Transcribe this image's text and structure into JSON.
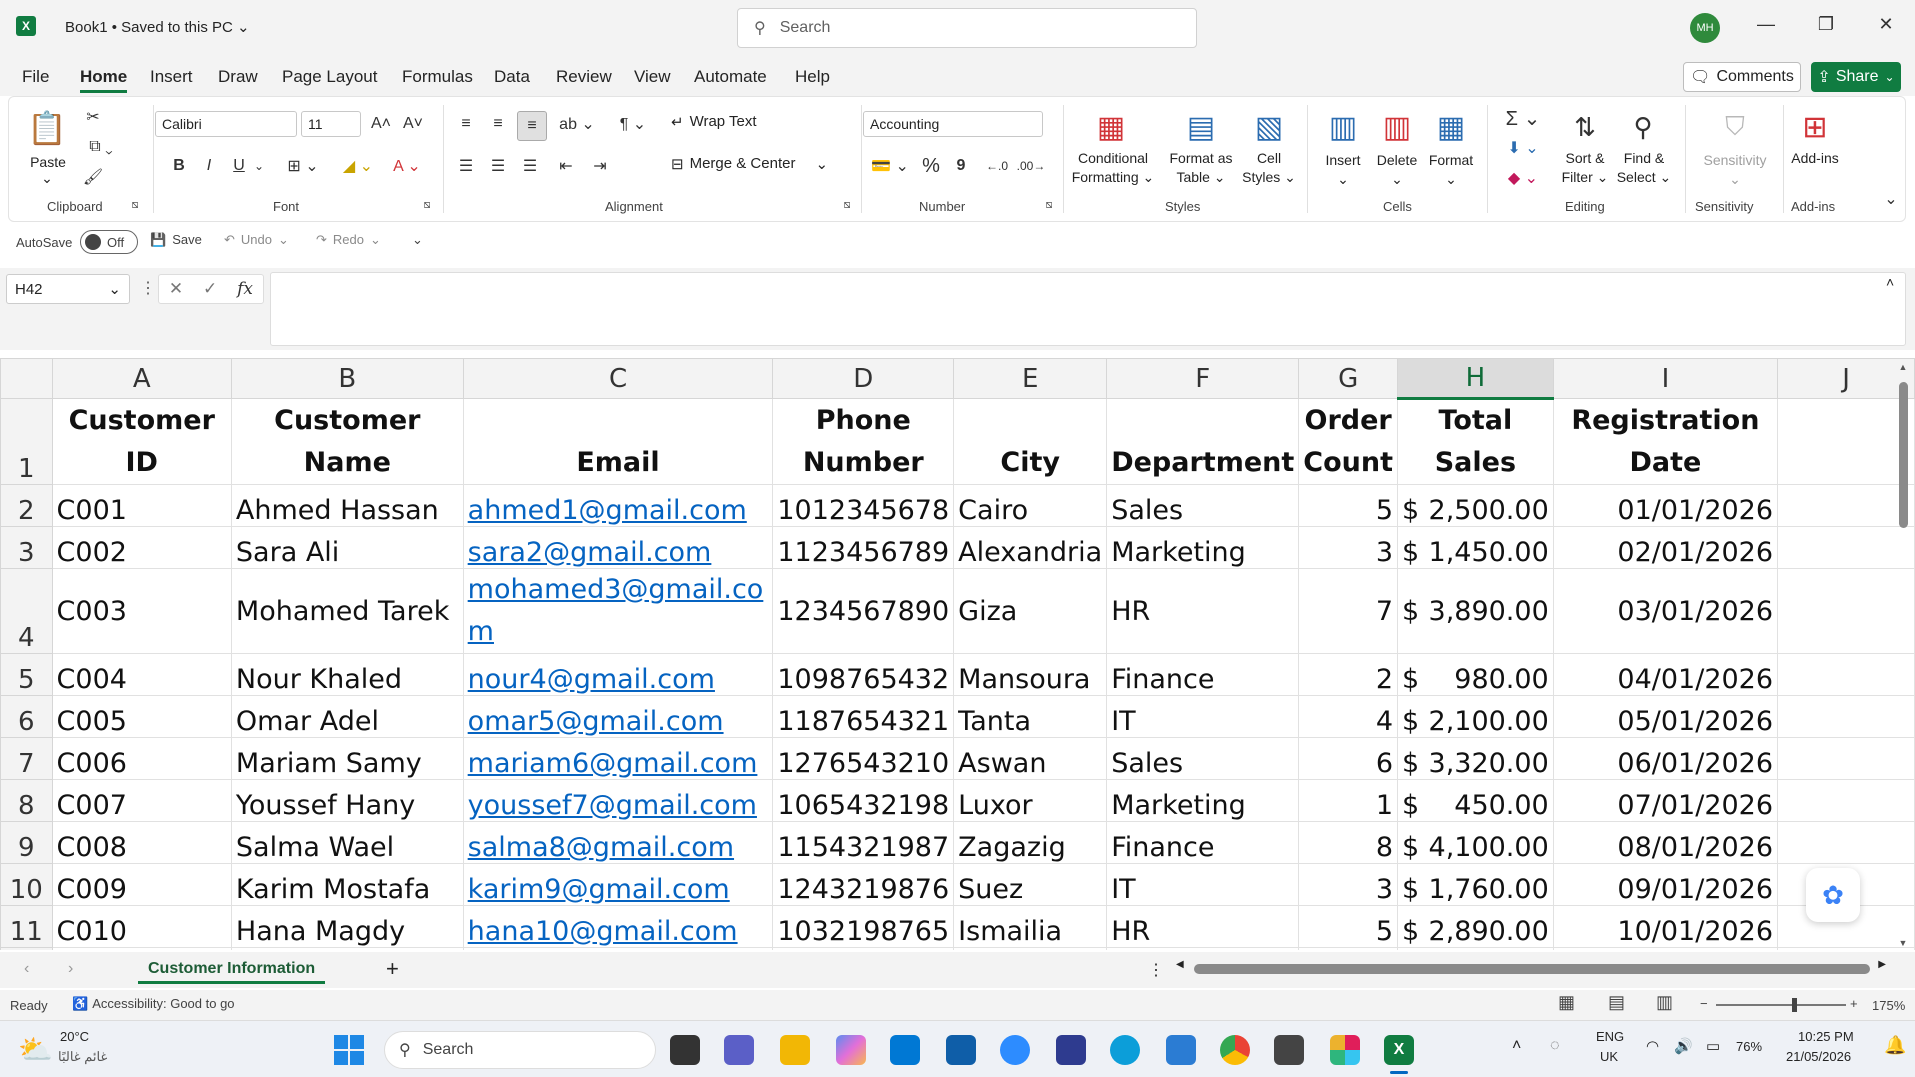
{
  "app": {
    "title": "Book1",
    "saved_status": "Saved to this PC",
    "search_placeholder": "Search",
    "user_initials": "MH"
  },
  "menu": {
    "tabs": [
      "File",
      "Home",
      "Insert",
      "Draw",
      "Page Layout",
      "Formulas",
      "Data",
      "Review",
      "View",
      "Automate",
      "Help"
    ],
    "active": "Home",
    "comments": "Comments",
    "share": "Share"
  },
  "ribbon": {
    "paste": "Paste",
    "clipboard": "Clipboard",
    "font_name": "Calibri",
    "font_size": "11",
    "bold": "B",
    "italic": "I",
    "underline": "U",
    "font": "Font",
    "wrap_text": "Wrap Text",
    "merge_center": "Merge & Center",
    "alignment": "Alignment",
    "number_format": "Accounting",
    "percent": "%",
    "comma": "9",
    "number": "Number",
    "conditional_formatting_1": "Conditional",
    "conditional_formatting_2": "Formatting",
    "format_table_1": "Format as",
    "format_table_2": "Table",
    "cell_styles_1": "Cell",
    "cell_styles_2": "Styles",
    "styles": "Styles",
    "insert": "Insert",
    "delete": "Delete",
    "format": "Format",
    "cells": "Cells",
    "sort_filter_1": "Sort &",
    "sort_filter_2": "Filter",
    "find_select_1": "Find &",
    "find_select_2": "Select",
    "editing": "Editing",
    "sensitivity": "Sensitivity",
    "add_ins": "Add-ins"
  },
  "qat": {
    "autosave": "AutoSave",
    "autosave_state": "Off",
    "save": "Save",
    "undo": "Undo",
    "redo": "Redo"
  },
  "formula_bar": {
    "cell_ref": "H42",
    "fx": "fx",
    "content": ""
  },
  "sheet": {
    "columns": [
      "A",
      "B",
      "C",
      "D",
      "E",
      "F",
      "G",
      "H",
      "I",
      "J"
    ],
    "selected_column": "H",
    "headers": [
      "Customer ID",
      "Customer Name",
      "Email",
      "Phone Number",
      "City",
      "Department",
      "Order Count",
      "Total Sales",
      "Registration Date"
    ],
    "rows": [
      {
        "row": "2",
        "id": "C001",
        "name": "Ahmed Hassan",
        "email": "ahmed1@gmail.com",
        "phone": "1012345678",
        "city": "Cairo",
        "dept": "Sales",
        "count": "5",
        "sales": "2,500.00",
        "date": "01/01/2026"
      },
      {
        "row": "3",
        "id": "C002",
        "name": "Sara Ali",
        "email": "sara2@gmail.com",
        "phone": "1123456789",
        "city": "Alexandria",
        "dept": "Marketing",
        "count": "3",
        "sales": "1,450.00",
        "date": "02/01/2026"
      },
      {
        "row": "4",
        "id": "C003",
        "name": "Mohamed Tarek",
        "email": "mohamed3@gmail.com",
        "phone": "1234567890",
        "city": "Giza",
        "dept": "HR",
        "count": "7",
        "sales": "3,890.00",
        "date": "03/01/2026"
      },
      {
        "row": "5",
        "id": "C004",
        "name": "Nour Khaled",
        "email": "nour4@gmail.com",
        "phone": "1098765432",
        "city": "Mansoura",
        "dept": "Finance",
        "count": "2",
        "sales": "980.00",
        "date": "04/01/2026"
      },
      {
        "row": "6",
        "id": "C005",
        "name": "Omar Adel",
        "email": "omar5@gmail.com",
        "phone": "1187654321",
        "city": "Tanta",
        "dept": "IT",
        "count": "4",
        "sales": "2,100.00",
        "date": "05/01/2026"
      },
      {
        "row": "7",
        "id": "C006",
        "name": "Mariam Samy",
        "email": "mariam6@gmail.com",
        "phone": "1276543210",
        "city": "Aswan",
        "dept": "Sales",
        "count": "6",
        "sales": "3,320.00",
        "date": "06/01/2026"
      },
      {
        "row": "8",
        "id": "C007",
        "name": "Youssef Hany",
        "email": "youssef7@gmail.com",
        "phone": "1065432198",
        "city": "Luxor",
        "dept": "Marketing",
        "count": "1",
        "sales": "450.00",
        "date": "07/01/2026"
      },
      {
        "row": "9",
        "id": "C008",
        "name": "Salma Wael",
        "email": "salma8@gmail.com",
        "phone": "1154321987",
        "city": "Zagazig",
        "dept": "Finance",
        "count": "8",
        "sales": "4,100.00",
        "date": "08/01/2026"
      },
      {
        "row": "10",
        "id": "C009",
        "name": "Karim Mostafa",
        "email": "karim9@gmail.com",
        "phone": "1243219876",
        "city": "Suez",
        "dept": "IT",
        "count": "3",
        "sales": "1,760.00",
        "date": "09/01/2026"
      },
      {
        "row": "11",
        "id": "C010",
        "name": "Hana Magdy",
        "email": "hana10@gmail.com",
        "phone": "1032198765",
        "city": "Ismailia",
        "dept": "HR",
        "count": "5",
        "sales": "2,890.00",
        "date": "10/01/2026"
      }
    ],
    "currency_symbol": "$"
  },
  "sheet_tabs": {
    "active": "Customer Information",
    "add": "+"
  },
  "status": {
    "ready": "Ready",
    "accessibility": "Accessibility: Good to go",
    "zoom": "175%"
  },
  "taskbar": {
    "weather_temp": "20°C",
    "weather_desc": "غائم غالبًا",
    "search": "Search",
    "lang_1": "ENG",
    "lang_2": "UK",
    "battery": "76%",
    "time": "10:25 PM",
    "date": "21/05/2026"
  },
  "colors": {
    "excel_green": "#107c41",
    "link_blue": "#0563c1",
    "chrome_bg": "#f3f3f3"
  }
}
